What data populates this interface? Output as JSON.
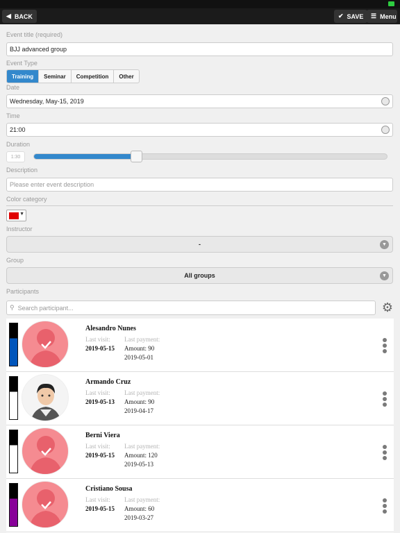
{
  "toolbar": {
    "back_label": "BACK",
    "save_label": "SAVE",
    "menu_label": "Menu"
  },
  "form": {
    "title_label": "Event title (required)",
    "title_value": "BJJ advanced group",
    "type_label": "Event Type",
    "types": [
      "Training",
      "Seminar",
      "Competition",
      "Other"
    ],
    "date_label": "Date",
    "date_value": "Wednesday, May-15, 2019",
    "time_label": "Time",
    "time_value": "21:00",
    "duration_label": "Duration",
    "duration_value": "1:30",
    "duration_fraction": 0.29,
    "description_label": "Description",
    "description_placeholder": "Please enter event description",
    "color_label": "Color category",
    "color_value": "#e00000",
    "instructor_label": "Instructor",
    "instructor_value": "-",
    "group_label": "Group",
    "group_value": "All groups",
    "participants_label": "Participants",
    "search_placeholder": "Search participant..."
  },
  "participants": [
    {
      "name": "Alesandro Nunes",
      "last_visit_label": "Last visit:",
      "last_visit": "2019-05-15",
      "last_payment_label": "Last payment:",
      "amount": "Amount: 90",
      "payment_date": "2019-05-01",
      "belt": [
        "#000000",
        "#0055bb"
      ],
      "checked": true
    },
    {
      "name": "Armando Cruz",
      "last_visit_label": "Last visit:",
      "last_visit": "2019-05-13",
      "last_payment_label": "Last payment:",
      "amount": "Amount: 90",
      "payment_date": "2019-04-17",
      "belt": [
        "#000000",
        "#ffffff"
      ],
      "checked": false
    },
    {
      "name": "Berni Viera",
      "last_visit_label": "Last visit:",
      "last_visit": "2019-05-15",
      "last_payment_label": "Last payment:",
      "amount": "Amount: 120",
      "payment_date": "2019-05-13",
      "belt": [
        "#000000",
        "#ffffff"
      ],
      "checked": true
    },
    {
      "name": "Cristiano Sousa",
      "last_visit_label": "Last visit:",
      "last_visit": "2019-05-15",
      "last_payment_label": "Last payment:",
      "amount": "Amount: 60",
      "payment_date": "2019-03-27",
      "belt": [
        "#000000",
        "#880099"
      ],
      "checked": true
    }
  ]
}
